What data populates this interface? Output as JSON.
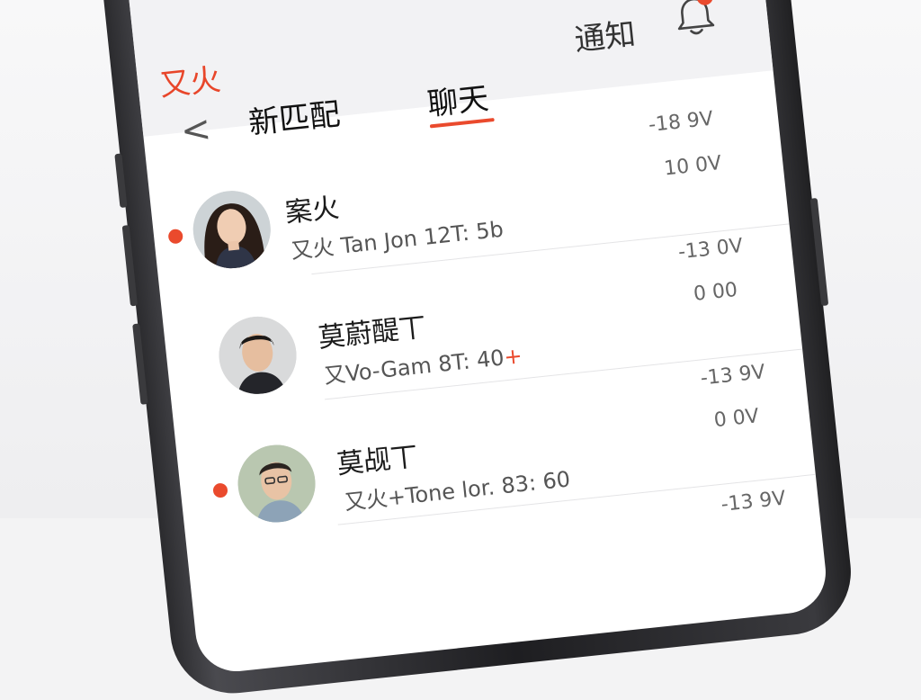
{
  "app": {
    "brand": "又火",
    "notice_label": "通知",
    "back_glyph": "<"
  },
  "tabs": [
    {
      "label": "新匹配",
      "active": false
    },
    {
      "label": "聊天",
      "active": true
    }
  ],
  "chats": [
    {
      "meta_top": "-18 9V",
      "name": "案火",
      "preview": "又火 Tan Jon 12T: 5b",
      "preview_accent": "",
      "meta_bottom": "10 0V",
      "unread": true
    },
    {
      "meta_top": "-13 0V",
      "name": "莫蔚醍丅",
      "preview": "又Vo-Gam 8T: 40",
      "preview_accent": "+",
      "meta_bottom": "0 00",
      "unread": false
    },
    {
      "meta_top": "-13 9V",
      "name": "莫觇丅",
      "preview": "又火+Tone lor. 83: 60",
      "preview_accent": "",
      "meta_bottom": "0 0V",
      "unread": true
    },
    {
      "meta_top": "-13 9V",
      "name": "",
      "preview": "",
      "preview_accent": "",
      "meta_bottom": "",
      "unread": false
    }
  ],
  "colors": {
    "accent": "#ea4a2d",
    "screen_bg": "#ffffff",
    "header_bg": "#f2f2f4"
  },
  "icons": {
    "bell": "bell-icon",
    "back": "chevron-left-icon"
  }
}
